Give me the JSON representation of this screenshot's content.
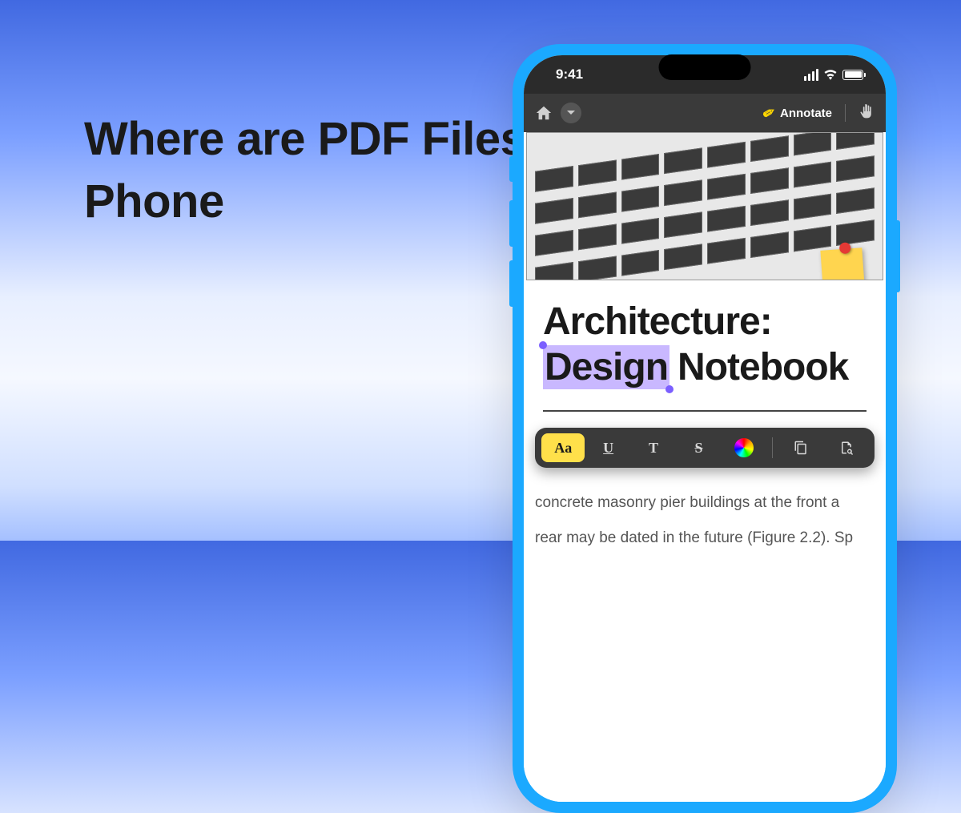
{
  "headline": "Where are PDF Files Stored on My Phone",
  "phone": {
    "status": {
      "time": "9:41"
    },
    "appbar": {
      "annotate_label": "Annotate"
    },
    "document": {
      "title_line1": "Architecture:",
      "title_highlighted": "Design",
      "title_rest": "Notebook",
      "body_line1": "concrete masonry pier buildings at the front a",
      "body_line2": "rear may be dated in the future (Figure 2.2). Sp"
    },
    "format_toolbar": {
      "highlight": "Aa",
      "underline": "U",
      "text": "T",
      "strike": "S"
    }
  }
}
